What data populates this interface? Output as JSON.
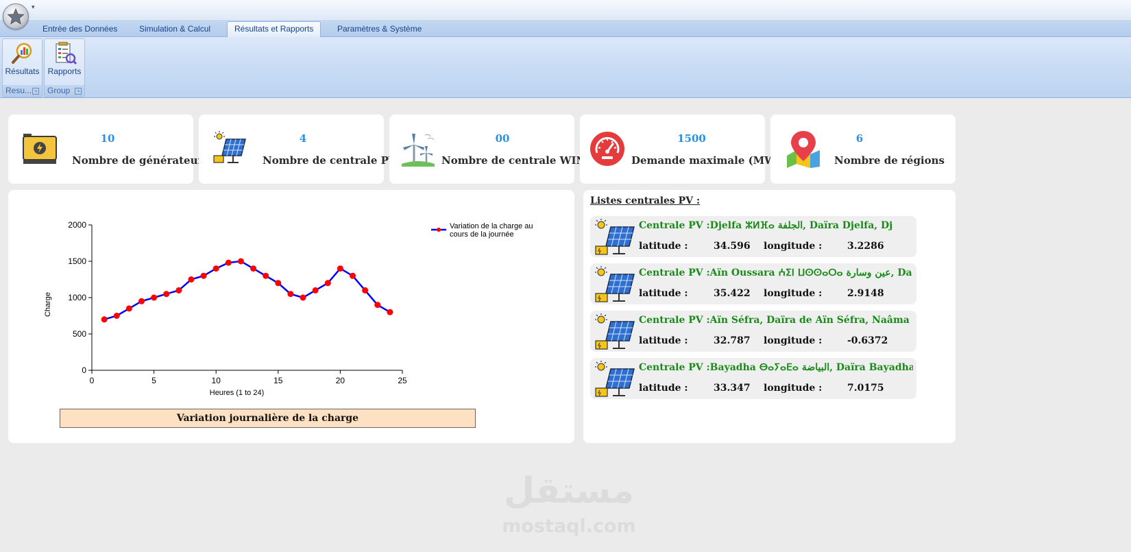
{
  "ribbon": {
    "tabs": [
      {
        "label": "Entrée des Données",
        "active": false
      },
      {
        "label": "Simulation & Calcul",
        "active": false
      },
      {
        "label": "Résultats et Rapports",
        "active": true
      },
      {
        "label": "Paramètres & Système",
        "active": false
      }
    ],
    "groups": [
      {
        "label": "Resu...",
        "button": "Résultats",
        "icon": "results-magnifier-icon"
      },
      {
        "label": "Group",
        "button": "Rapports",
        "icon": "report-icon"
      }
    ],
    "qat_arrow": "▾",
    "app_button_icon": "star-icon"
  },
  "stats": [
    {
      "value": "10",
      "label": "Nombre de générateurs",
      "icon": "generator-icon"
    },
    {
      "value": "4",
      "label": "Nombre de centrale PV",
      "icon": "solar-panel-icon"
    },
    {
      "value": "00",
      "label": "Nombre de centrale WIND",
      "icon": "wind-turbine-icon"
    },
    {
      "value": "1500",
      "label": "Demande maximale (MW)",
      "icon": "gauge-icon"
    },
    {
      "value": "6",
      "label": "Nombre de régions",
      "icon": "map-pin-icon"
    }
  ],
  "chart_caption": "Variation journalière de la charge",
  "chart_data": {
    "type": "line",
    "x": [
      1,
      2,
      3,
      4,
      5,
      6,
      7,
      8,
      9,
      10,
      11,
      12,
      13,
      14,
      15,
      16,
      17,
      18,
      19,
      20,
      21,
      22,
      23,
      24
    ],
    "series": [
      {
        "name": "Variation de la charge au cours de la journée",
        "values": [
          700,
          750,
          850,
          950,
          1000,
          1050,
          1100,
          1250,
          1300,
          1400,
          1480,
          1500,
          1400,
          1300,
          1200,
          1050,
          1000,
          1100,
          1200,
          1400,
          1300,
          1100,
          900,
          800
        ],
        "color": "#0000ff",
        "marker_color": "#ff0000"
      }
    ],
    "xlabel": "Heures (1 to 24)",
    "ylabel": "Charge",
    "xlim": [
      0,
      25
    ],
    "ylim": [
      0,
      2000
    ],
    "xticks": [
      0,
      5,
      10,
      15,
      20,
      25
    ],
    "yticks": [
      0,
      500,
      1000,
      1500,
      2000
    ],
    "legend_position": "top-right",
    "legend_lines": [
      "Variation de la charge au",
      "cours de la journée"
    ],
    "grid": false
  },
  "pv_list": {
    "title": "Listes centrales PV :",
    "lat_label": "latitude :",
    "lon_label": "longitude :",
    "items": [
      {
        "name": "Centrale PV :Djelfa ⵣⵍⴼⴰ الجلفة, Daïra Djelfa, Dj",
        "lat": "34.596",
        "lon": "3.2286"
      },
      {
        "name": "Centrale PV :Aïn Oussara ⵄⵉⵏ ⵡⵙⵙⴰⵔⴰ عين وسارة, Da",
        "lat": "35.422",
        "lon": "2.9148"
      },
      {
        "name": "Centrale PV :Aïn Séfra, Daïra de Aïn Séfra, Naâma",
        "lat": "32.787",
        "lon": "-0.6372"
      },
      {
        "name": "Centrale PV :Bayadha ⴱⴰⵢⴰⴹⴰ البياضة, Daïra Bayadha",
        "lat": "33.347",
        "lon": "7.0175"
      }
    ]
  },
  "watermark": {
    "logo": "مستقل",
    "text": "mostaql.com"
  }
}
